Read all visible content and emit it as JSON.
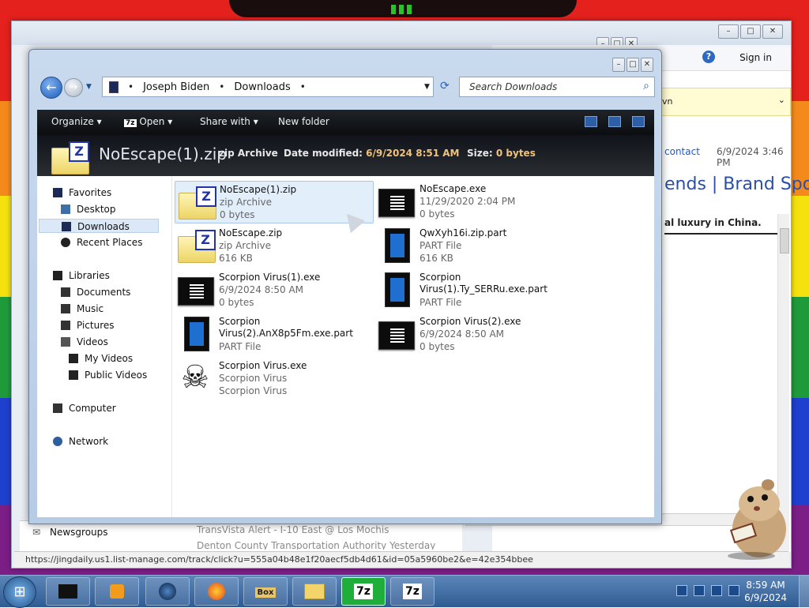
{
  "explorer": {
    "breadcrumb": [
      "Joseph Biden",
      "Downloads"
    ],
    "search_placeholder": "Search Downloads",
    "commands": {
      "organize": "Organize",
      "open": "Open",
      "share_with": "Share with",
      "new_folder": "New folder"
    },
    "details": {
      "name": "NoEscape(1).zip",
      "type": "zip Archive",
      "date_label": "Date modified:",
      "date_value": "6/9/2024 8:51 AM",
      "size_label": "Size:",
      "size_value": "0 bytes"
    },
    "nav": {
      "favorites": "Favorites",
      "desktop": "Desktop",
      "downloads": "Downloads",
      "recent_places": "Recent Places",
      "libraries": "Libraries",
      "documents": "Documents",
      "music": "Music",
      "pictures": "Pictures",
      "videos": "Videos",
      "my_videos": "My Videos",
      "public_videos": "Public Videos",
      "computer": "Computer",
      "network": "Network"
    },
    "files": [
      {
        "name": "NoEscape(1).zip",
        "line1": "zip Archive",
        "line2": "0 bytes",
        "icon": "zip-icon"
      },
      {
        "name": "NoEscape.exe",
        "line1": "11/29/2020 2:04 PM",
        "line2": "0 bytes",
        "icon": "exe-icon"
      },
      {
        "name": "NoEscape.zip",
        "line1": "zip Archive",
        "line2": "616 KB",
        "icon": "zip-icon"
      },
      {
        "name": "QwXyh16i.zip.part",
        "line1": "PART File",
        "line2": "616 KB",
        "icon": "part-file-icon"
      },
      {
        "name": "Scorpion Virus(1).exe",
        "line1": "6/9/2024 8:50 AM",
        "line2": "0 bytes",
        "icon": "exe-icon"
      },
      {
        "name": "Scorpion Virus(1).Ty_SERRu.exe.part",
        "line1": "PART File",
        "line2": "",
        "icon": "part-file-icon"
      },
      {
        "name": "Scorpion Virus(2).AnX8p5Fm.exe.part",
        "line1": "PART File",
        "line2": "",
        "icon": "part-file-icon"
      },
      {
        "name": "Scorpion Virus(2).exe",
        "line1": "6/9/2024 8:50 AM",
        "line2": "0 bytes",
        "icon": "exe-icon"
      },
      {
        "name": "Scorpion Virus.exe",
        "line1": "Scorpion Virus",
        "line2": "Scorpion Virus",
        "icon": "skull-icon"
      }
    ]
  },
  "email": {
    "sign_in": "Sign in",
    "banner_text": "vn",
    "contact": "contact",
    "date": "6/9/2024 3:46 PM",
    "heading": "ends | Brand Spo",
    "line": "al luxury in China.",
    "newsgroups": "Newsgroups",
    "alert1": "TransVista Alert - I-10 East @ Los Mochis",
    "alert2": "Denton County Transportation Authority    Yesterday"
  },
  "status_url": "https://jingdaily.us1.list-manage.com/track/click?u=555a04b48e1f20aecf5db4d61&id=05a5960be2&e=42e354bbee",
  "taskbar": {
    "time": "8:59 AM",
    "date": "6/9/2024",
    "sevenzip1": "7z",
    "sevenzip2": "7z",
    "box_label": "Box"
  }
}
